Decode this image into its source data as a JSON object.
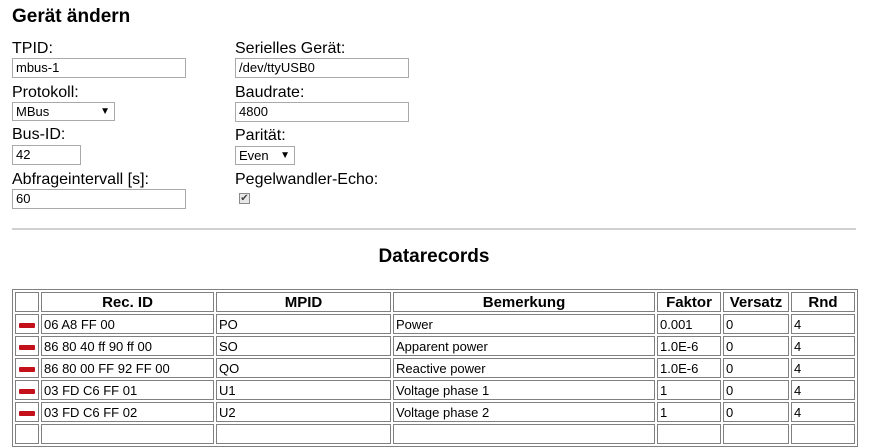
{
  "page": {
    "title": "Gerät ändern"
  },
  "form": {
    "tpid": {
      "label": "TPID:",
      "value": "mbus-1"
    },
    "protokoll": {
      "label": "Protokoll:",
      "selected": "MBus"
    },
    "bus_id": {
      "label": "Bus-ID:",
      "value": "42"
    },
    "abfrageintervall": {
      "label": "Abfrageintervall [s]:",
      "value": "60"
    },
    "serielles_geraet": {
      "label": "Serielles Gerät:",
      "value": "/dev/ttyUSB0"
    },
    "baudrate": {
      "label": "Baudrate:",
      "value": "4800"
    },
    "paritaet": {
      "label": "Parität:",
      "selected": "Even"
    },
    "pegelwandler_echo": {
      "label": "Pegelwandler-Echo:",
      "checked": true
    }
  },
  "datarecords": {
    "title": "Datarecords",
    "columns": [
      "",
      "Rec. ID",
      "MPID",
      "Bemerkung",
      "Faktor",
      "Versatz",
      "Rnd"
    ],
    "rows": [
      {
        "rec_id": "06 A8 FF 00",
        "mpid": "PO",
        "bemerkung": "Power",
        "faktor": "0.001",
        "versatz": "0",
        "rnd": "4"
      },
      {
        "rec_id": "86 80 40 ff 90 ff 00",
        "mpid": "SO",
        "bemerkung": "Apparent power",
        "faktor": "1.0E-6",
        "versatz": "0",
        "rnd": "4"
      },
      {
        "rec_id": "86 80 00 FF 92 FF 00",
        "mpid": "QO",
        "bemerkung": "Reactive power",
        "faktor": "1.0E-6",
        "versatz": "0",
        "rnd": "4"
      },
      {
        "rec_id": "03 FD C6 FF 01",
        "mpid": "U1",
        "bemerkung": "Voltage phase 1",
        "faktor": "1",
        "versatz": "0",
        "rnd": "4"
      },
      {
        "rec_id": "03 FD C6 FF 02",
        "mpid": "U2",
        "bemerkung": "Voltage phase 2",
        "faktor": "1",
        "versatz": "0",
        "rnd": "4"
      },
      {
        "rec_id": "",
        "mpid": "",
        "bemerkung": "",
        "faktor": "",
        "versatz": "",
        "rnd": ""
      }
    ]
  },
  "colors": {
    "delete_icon": "#c4101a",
    "border": "#808080",
    "separator": "#d0d0d0"
  }
}
